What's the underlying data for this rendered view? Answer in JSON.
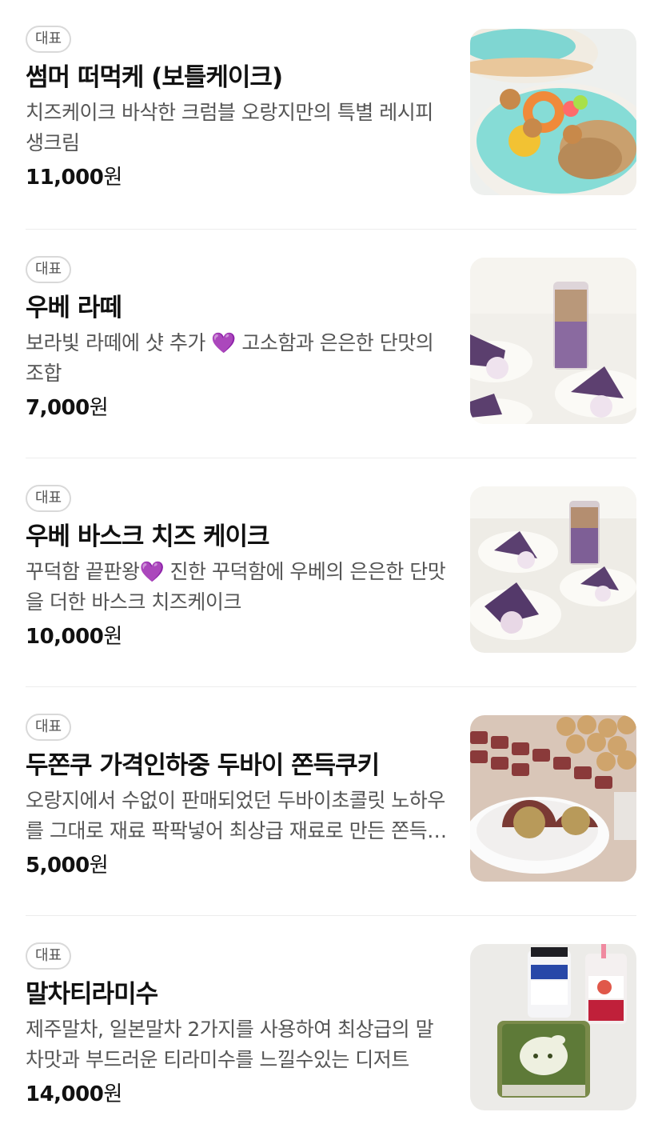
{
  "menu_items": [
    {
      "badge": "대표",
      "name": "썸머 떠먹케 (보틀케이크)",
      "description": "치즈케이크 바삭한 크럼블 오랑지만의 특별 레시피 생크림",
      "price": "11,000",
      "currency": "원",
      "image": "summer-bottle-cake-photo"
    },
    {
      "badge": "대표",
      "name": "우베 라떼",
      "description": "보라빛 라떼에 샷 추가 💜 고소함과 은은한 단맛의 조합",
      "price": "7,000",
      "currency": "원",
      "image": "ube-latte-photo"
    },
    {
      "badge": "대표",
      "name": "우베 바스크 치즈 케이크",
      "description": "꾸덕함 끝판왕💜 진한 꾸덕함에 우베의 은은한 단맛을 더한 바스크 치즈케이크",
      "price": "10,000",
      "currency": "원",
      "image": "ube-basque-cheesecake-photo"
    },
    {
      "badge": "대표",
      "name": "두쫀쿠 가격인하중 두바이 쫀득쿠키",
      "description": "오랑지에서 수없이 판매되었던 두바이초콜릿 노하우를 그대로 재료 팍팍넣어 최상급 재료로 만든 쫀득쿠키",
      "price": "5,000",
      "currency": "원",
      "image": "dubai-chewy-cookie-photo"
    },
    {
      "badge": "대표",
      "name": "말차티라미수",
      "description": "제주말차, 일본말차 2가지를 사용하여 최상급의 말차맛과 부드러운 티라미수를 느낄수있는 디저트",
      "price": "14,000",
      "currency": "원",
      "image": "matcha-tiramisu-photo"
    }
  ]
}
